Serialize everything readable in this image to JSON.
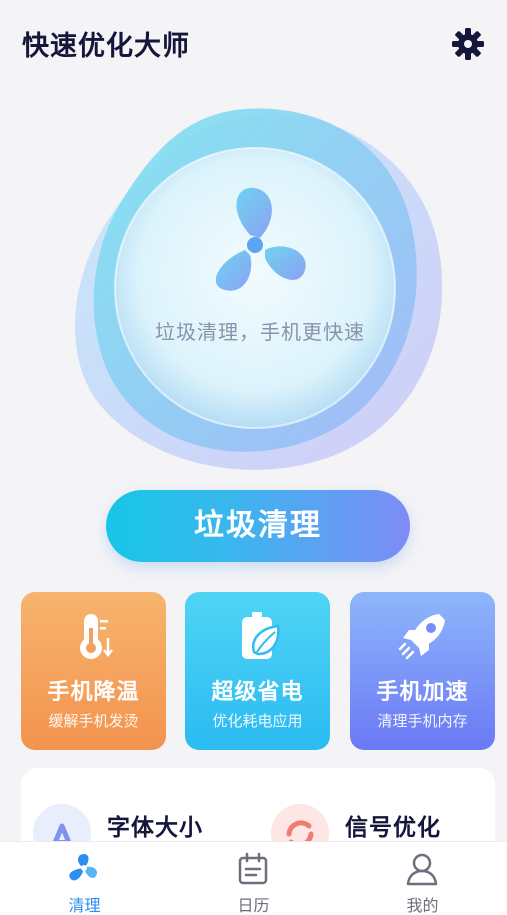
{
  "header": {
    "title": "快速优化大师",
    "settings_icon": "gear-icon"
  },
  "hero": {
    "tagline": "垃圾清理，手机更快速",
    "icon": "fan-icon"
  },
  "primary_action": {
    "label": "垃圾清理"
  },
  "feature_cards": [
    {
      "title": "手机降温",
      "subtitle": "缓解手机发烫",
      "icon": "thermometer-icon",
      "color": "#f3a05c"
    },
    {
      "title": "超级省电",
      "subtitle": "优化耗电应用",
      "icon": "battery-leaf-icon",
      "color": "#36c6f4"
    },
    {
      "title": "手机加速",
      "subtitle": "清理手机内存",
      "icon": "rocket-icon",
      "color": "#7a8cf7"
    }
  ],
  "tools": [
    {
      "label": "字体大小",
      "icon": "font-size-icon"
    },
    {
      "label": "信号优化",
      "icon": "signal-refresh-icon"
    }
  ],
  "tabbar": {
    "items": [
      {
        "label": "清理",
        "icon": "pinwheel-icon",
        "active": true
      },
      {
        "label": "日历",
        "icon": "calendar-icon",
        "active": false
      },
      {
        "label": "我的",
        "icon": "person-icon",
        "active": false
      }
    ],
    "active_color": "#2b8ff0"
  }
}
